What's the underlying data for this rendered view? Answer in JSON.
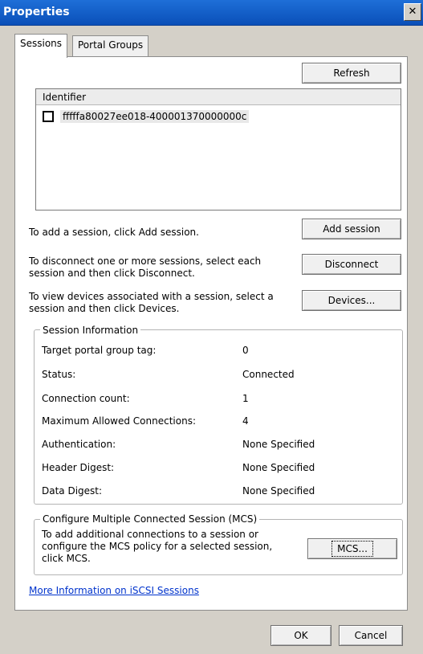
{
  "window": {
    "title": "Properties",
    "close_glyph": "✕"
  },
  "tabs": [
    {
      "label": "Sessions"
    },
    {
      "label": "Portal Groups"
    }
  ],
  "sessions": {
    "refresh_label": "Refresh",
    "list": {
      "header": "Identifier",
      "rows": [
        {
          "identifier": "fffffa80027ee018-400001370000000c",
          "checked": false
        }
      ]
    },
    "add_text": "To add a session, click Add session.",
    "add_label": "Add session",
    "disconnect_text": "To disconnect one or more sessions, select each session and then click Disconnect.",
    "disconnect_label": "Disconnect",
    "devices_text": "To view devices associated with a session, select a session and then click Devices.",
    "devices_label": "Devices..."
  },
  "session_info": {
    "legend": "Session Information",
    "rows": [
      {
        "label": "Target portal group tag:",
        "value": "0"
      },
      {
        "label": "Status:",
        "value": "Connected"
      },
      {
        "label": "Connection count:",
        "value": "1"
      },
      {
        "label": "Maximum Allowed Connections:",
        "value": "4"
      },
      {
        "label": "Authentication:",
        "value": "None Specified"
      },
      {
        "label": "Header Digest:",
        "value": "None Specified"
      },
      {
        "label": "Data Digest:",
        "value": "None Specified"
      }
    ]
  },
  "mcs": {
    "legend": "Configure Multiple Connected Session (MCS)",
    "text": "To add additional connections to a session or configure the MCS policy for a selected session, click MCS.",
    "button_label": "MCS..."
  },
  "more_info_link": "More Information on iSCSI Sessions",
  "footer": {
    "ok_label": "OK",
    "cancel_label": "Cancel"
  },
  "colors": {
    "titlebar": "#0a4fb8",
    "link": "#0033cc",
    "dialog_bg": "#d4d0c8"
  }
}
